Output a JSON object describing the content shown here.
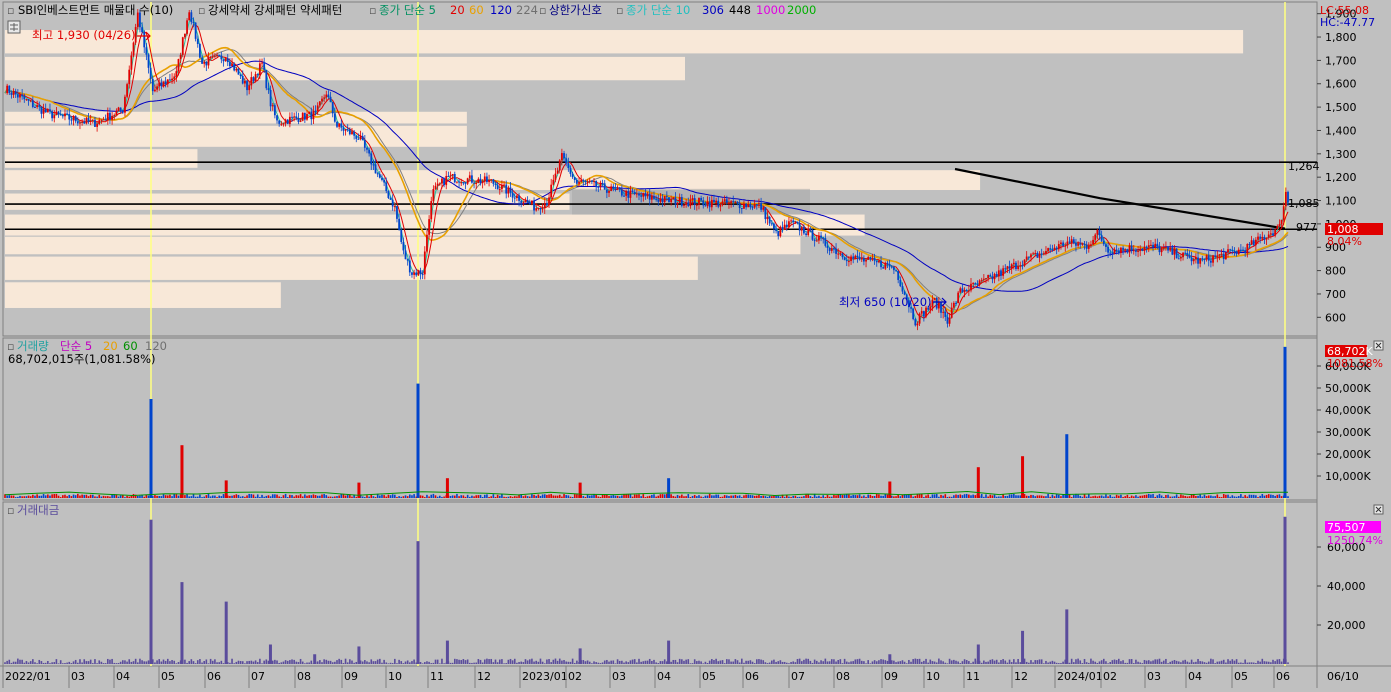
{
  "header": {
    "stock_name": "SBI인베스트먼트 매물대 수(10)",
    "pattern_label": "강세약세 강세패턴  약세패턴",
    "ma_label": "종가 단순 5",
    "ma_periods": [
      "20",
      "60",
      "120",
      "224"
    ],
    "limit_label": "상한가신호",
    "ma2_label": "종가 단순 10",
    "ma2_periods": [
      "306",
      "448",
      "1000",
      "2000"
    ],
    "lc": "LC:55.08",
    "hc": "HC:-47.77"
  },
  "price_panel": {
    "high_annotation": "최고 1,930 (04/26)",
    "low_annotation": "최저 650 (10/20)",
    "levels": [
      "1,264",
      "1,085",
      "977"
    ],
    "current_price": "1,008",
    "current_change": "8.04%",
    "y_ticks": [
      {
        "label": "1,900",
        "v": 1900
      },
      {
        "label": "1,800",
        "v": 1800
      },
      {
        "label": "1,700",
        "v": 1700
      },
      {
        "label": "1,600",
        "v": 1600
      },
      {
        "label": "1,500",
        "v": 1500
      },
      {
        "label": "1,400",
        "v": 1400
      },
      {
        "label": "1,300",
        "v": 1300
      },
      {
        "label": "1,200",
        "v": 1200
      },
      {
        "label": "1,100",
        "v": 1100
      },
      {
        "label": "1,000",
        "v": 1000
      },
      {
        "label": "900",
        "v": 900
      },
      {
        "label": "800",
        "v": 800
      },
      {
        "label": "700",
        "v": 700
      },
      {
        "label": "600",
        "v": 600
      }
    ]
  },
  "volume_panel": {
    "title": "거래량",
    "ma_label": "단순 5",
    "ma_periods": [
      "20",
      "60",
      "120"
    ],
    "info": "68,702,015주(1,081.58%)",
    "current_value": "68,702K",
    "current_pct": "1081.58%",
    "y_ticks": [
      "60,000K",
      "50,000K",
      "40,000K",
      "30,000K",
      "20,000K",
      "10,000K"
    ]
  },
  "amount_panel": {
    "title": "거래대금",
    "current_value": "75,507",
    "current_pct": "1250.74%",
    "y_ticks": [
      "60,000",
      "40,000",
      "20,000"
    ]
  },
  "x_axis": {
    "labels": [
      "2022/01",
      "03",
      "04",
      "05",
      "06",
      "07",
      "08",
      "09",
      "10",
      "11",
      "12",
      "2023/01",
      "02",
      "03",
      "04",
      "05",
      "06",
      "07",
      "08",
      "09",
      "10",
      "11",
      "12",
      "2024/01",
      "02",
      "03",
      "04",
      "05",
      "06"
    ],
    "current_date": "06/10"
  },
  "colors": {
    "bg": "#c0c0c0",
    "up": "#e00000",
    "down": "#0044cc",
    "volume_profile": "#f8e8d8",
    "ma5": "#e00000",
    "ma20": "#e8a000",
    "ma60": "#0000c0",
    "ma120": "#808080",
    "amount_bar": "#5a4c9c",
    "event_line": "#ffff80"
  },
  "chart_data": [
    {
      "type": "line",
      "title": "SBI인베스트먼트",
      "x": [
        "2022/01",
        "2022/02",
        "2022/03",
        "2022/04",
        "2022/05",
        "2022/06",
        "2022/07",
        "2022/08",
        "2022/09",
        "2022/10",
        "2022/11",
        "2022/12",
        "2023/01",
        "2023/02",
        "2023/03",
        "2023/04",
        "2023/05",
        "2023/06",
        "2023/07",
        "2023/08",
        "2023/09",
        "2023/10",
        "2023/11",
        "2023/12",
        "2024/01",
        "2024/02",
        "2024/03",
        "2024/04",
        "2024/05",
        "2024/06"
      ],
      "series": [
        {
          "values": [
            1580,
            1470,
            1430,
            1520,
            1660,
            1720,
            1430,
            1470,
            1370,
            1000,
            1200,
            1180,
            1070,
            1180,
            1130,
            1100,
            1090,
            1080,
            980,
            860,
            820,
            670,
            740,
            840,
            920,
            890,
            900,
            840,
            890,
            1008
          ]
        }
      ],
      "ylim": [
        520,
        1950
      ],
      "annotations": [
        "최고 1,930 (04/26)",
        "최저 650 (10/20)"
      ]
    },
    {
      "type": "bar",
      "title": "거래량",
      "x": [
        "2022/01",
        "2022/02",
        "2022/03",
        "2022/04",
        "2022/05",
        "2022/06",
        "2022/07",
        "2022/08",
        "2022/09",
        "2022/10",
        "2022/11",
        "2022/12",
        "2023/01",
        "2023/02",
        "2023/03",
        "2023/04",
        "2023/05",
        "2023/06",
        "2023/07",
        "2023/08",
        "2023/09",
        "2023/10",
        "2023/11",
        "2023/12",
        "2024/01",
        "2024/02",
        "2024/03",
        "2024/04",
        "2024/05",
        "2024/06"
      ],
      "series": [
        {
          "name": "거래량",
          "values": [
            1500,
            1200,
            1800,
            45000,
            24000,
            8000,
            3000,
            2500,
            7000,
            52000,
            9000,
            3000,
            3500,
            7000,
            2500,
            9000,
            2000,
            1500,
            1200,
            2500,
            7500,
            1500,
            14000,
            19000,
            29000,
            3000,
            2000,
            1500,
            1500,
            68702
          ]
        }
      ],
      "ylabel": "K",
      "ylim": [
        0,
        70000
      ]
    },
    {
      "type": "bar",
      "title": "거래대금",
      "x": [
        "2022/01",
        "2022/02",
        "2022/03",
        "2022/04",
        "2022/05",
        "2022/06",
        "2022/07",
        "2022/08",
        "2022/09",
        "2022/10",
        "2022/11",
        "2022/12",
        "2023/01",
        "2023/02",
        "2023/03",
        "2023/04",
        "2023/05",
        "2023/06",
        "2023/07",
        "2023/08",
        "2023/09",
        "2023/10",
        "2023/11",
        "2023/12",
        "2024/01",
        "2024/02",
        "2024/03",
        "2024/04",
        "2024/05",
        "2024/06"
      ],
      "series": [
        {
          "name": "거래대금",
          "values": [
            2500,
            2000,
            2500,
            74000,
            42000,
            32000,
            10000,
            5000,
            9000,
            63000,
            12000,
            4000,
            4000,
            8000,
            3000,
            12000,
            2500,
            2000,
            1500,
            3000,
            5000,
            1500,
            10000,
            17000,
            28000,
            3500,
            2000,
            1500,
            1500,
            75507
          ]
        }
      ],
      "ylim": [
        0,
        80000
      ]
    }
  ]
}
